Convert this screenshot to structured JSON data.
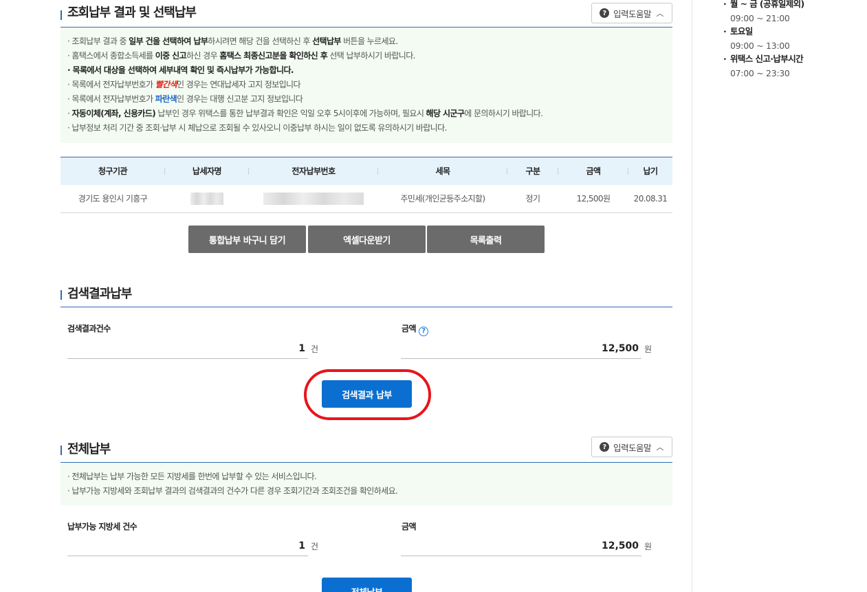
{
  "sidebar": {
    "weekday_label": "월 ~ 금 (공휴일제외)",
    "weekday_time": "09:00 ~ 21:00",
    "saturday_label": "토요일",
    "saturday_time": "09:00 ~ 13:00",
    "wetax_label": "위택스 신고·납부시간",
    "wetax_time": "07:00 ~ 23:30"
  },
  "section1": {
    "title": "조회납부 결과 및 선택납부",
    "help_label": "입력도움말",
    "notes": [
      [
        "· 조회납부 결과 중 ",
        "일부 건을 선택하여 납부",
        "하시려면 해당 건을 선택하신 후 ",
        "선택납부",
        " 버튼을 누르세요."
      ],
      [
        "· 홈택스에서 종합소득세를 ",
        "이중 신고",
        "하신 경우 ",
        "홈택스 최종신고분을 확인하신 후",
        " 선택 납부하시기 바랍니다."
      ],
      "· 목록에서 대상을 선택하여 세부내역 확인 및 즉시납부가 가능합니다.",
      [
        "· 목록에서 전자납부번호가 ",
        "빨간색",
        "인 경우는 연대납세자 고지 정보입니다"
      ],
      [
        "· 목록에서 전자납부번호가 ",
        "파란색",
        "인 경우는 대행 신고분 고지 정보입니다"
      ],
      [
        "· ",
        "자동이체(계좌, 신용카드)",
        " 납부인 경우 위택스를 통한 납부결과 확인은 익일 오후 5시이후에 가능하며, 필요시 ",
        "해당 시군구",
        "에 문의하시기 바랍니다."
      ],
      "· 납부정보 처리 기간 중 조회·납부 시 체납으로 조회될 수 있사오니 이중납부 하시는 일이 없도록 유의하시기 바랍니다."
    ],
    "table": {
      "headers": [
        "청구기관",
        "납세자명",
        "전자납부번호",
        "세목",
        "구분",
        "금액",
        "납기"
      ],
      "rows": [
        {
          "agency": "경기도 용인시 기흥구",
          "tax_item": "주민세(개인균등주소지할)",
          "type": "정기",
          "amount": "12,500원",
          "due": "20.08.31"
        }
      ]
    },
    "buttons": {
      "basket": "통합납부 바구니 담기",
      "excel": "엑셀다운받기",
      "print": "목록출력"
    }
  },
  "section2": {
    "title": "검색결과납부",
    "count_label": "검색결과건수",
    "count_value": "1",
    "count_unit": "건",
    "amount_label": "금액",
    "amount_value": "12,500",
    "amount_unit": "원",
    "pay_button": "검색결과 납부"
  },
  "section3": {
    "title": "전체납부",
    "help_label": "입력도움말",
    "notes": [
      "· 전체납부는 납부 가능한 모든 지방세를 한번에 납부할 수 있는 서비스입니다.",
      "· 납부가능 지방세와 조회납부 결과의 검색결과의 건수가 다른 경우 조회기간과 조회조건을 확인하세요."
    ],
    "count_label": "납부가능 지방세 건수",
    "count_value": "1",
    "count_unit": "건",
    "amount_label": "금액",
    "amount_value": "12,500",
    "amount_unit": "원",
    "pay_button": "전체납부"
  },
  "colors": {
    "accent_blue": "#0a6fd1",
    "heading_line": "#2c6ab5",
    "notice_bg": "#f3fbf2",
    "table_head_bg": "#e7f3fb",
    "grey_button": "#6b6b6b",
    "highlight_ring": "#e8141b"
  }
}
